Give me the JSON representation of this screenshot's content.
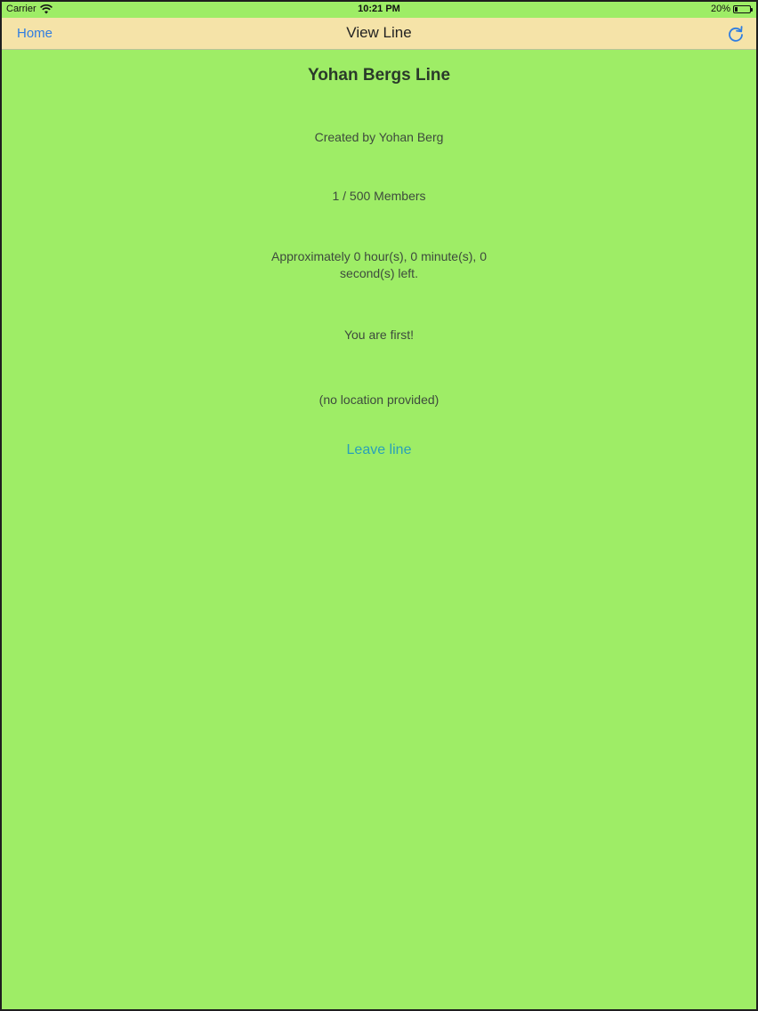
{
  "status_bar": {
    "carrier": "Carrier",
    "time": "10:21 PM",
    "battery": "20%",
    "battery_level": 0.2,
    "icons": [
      "wifi-icon",
      "battery-icon"
    ]
  },
  "nav_bar": {
    "back_label": "Home",
    "title": "View Line",
    "action_icon": "refresh-icon"
  },
  "line": {
    "title": "Yohan Bergs Line",
    "creator": "Created by Yohan Berg",
    "members": "1 / 500 Members",
    "eta": "Approximately 0 hour(s), 0 minute(s), 0 second(s) left.",
    "position": "You are first!",
    "location": "(no location provided)",
    "leave_label": "Leave line"
  },
  "colors": {
    "background": "#9eed66",
    "nav_background": "#f5e3a8",
    "link": "#2f7de1",
    "leave_link": "#2aa0b8"
  }
}
